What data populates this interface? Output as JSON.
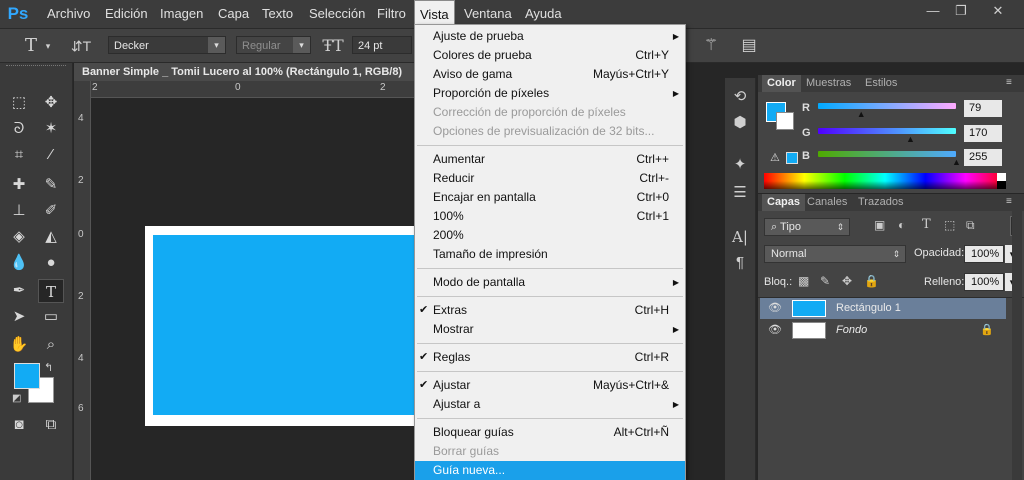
{
  "menubar": {
    "logo": "Ps",
    "items": [
      "Archivo",
      "Edición",
      "Imagen",
      "Capa",
      "Texto",
      "Selección",
      "Filtro",
      "Vista",
      "Ventana",
      "Ayuda"
    ],
    "active": "Vista"
  },
  "window_controls": {
    "minimize": "—",
    "restore": "❐",
    "close": "✕"
  },
  "options_bar": {
    "font_family": "Decker",
    "font_style": "Regular",
    "font_size": "24 pt"
  },
  "document": {
    "tab_title": "Banner Simple _ Tomii Lucero al 100% (Rectángulo 1, RGB/8)",
    "ruler_top": [
      "2",
      "0",
      "2"
    ],
    "ruler_left": [
      "4",
      "2",
      "0",
      "2",
      "4",
      "6"
    ],
    "colors": {
      "border": "#ffffff",
      "fill": "#12abf4"
    }
  },
  "vista_menu": {
    "items": [
      {
        "label": "Ajuste de prueba",
        "shortcut": "",
        "submenu": true,
        "checked": false,
        "disabled": false
      },
      {
        "label": "Colores de prueba",
        "shortcut": "Ctrl+Y",
        "submenu": false,
        "checked": false,
        "disabled": false
      },
      {
        "label": "Aviso de gama",
        "shortcut": "Mayús+Ctrl+Y",
        "submenu": false,
        "checked": false,
        "disabled": false
      },
      {
        "label": "Proporción de píxeles",
        "shortcut": "",
        "submenu": true,
        "checked": false,
        "disabled": false
      },
      {
        "label": "Corrección de proporción de píxeles",
        "shortcut": "",
        "submenu": false,
        "checked": false,
        "disabled": true
      },
      {
        "label": "Opciones de previsualización de 32 bits...",
        "shortcut": "",
        "submenu": false,
        "checked": false,
        "disabled": true
      },
      {
        "label": "Aumentar",
        "shortcut": "Ctrl++",
        "submenu": false,
        "checked": false,
        "disabled": false
      },
      {
        "label": "Reducir",
        "shortcut": "Ctrl+-",
        "submenu": false,
        "checked": false,
        "disabled": false
      },
      {
        "label": "Encajar en pantalla",
        "shortcut": "Ctrl+0",
        "submenu": false,
        "checked": false,
        "disabled": false
      },
      {
        "label": "100%",
        "shortcut": "Ctrl+1",
        "submenu": false,
        "checked": false,
        "disabled": false
      },
      {
        "label": "200%",
        "shortcut": "",
        "submenu": false,
        "checked": false,
        "disabled": false
      },
      {
        "label": "Tamaño de impresión",
        "shortcut": "",
        "submenu": false,
        "checked": false,
        "disabled": false
      },
      {
        "label": "Modo de pantalla",
        "shortcut": "",
        "submenu": true,
        "checked": false,
        "disabled": false
      },
      {
        "label": "Extras",
        "shortcut": "Ctrl+H",
        "submenu": false,
        "checked": true,
        "disabled": false
      },
      {
        "label": "Mostrar",
        "shortcut": "",
        "submenu": true,
        "checked": false,
        "disabled": false
      },
      {
        "label": "Reglas",
        "shortcut": "Ctrl+R",
        "submenu": false,
        "checked": true,
        "disabled": false
      },
      {
        "label": "Ajustar",
        "shortcut": "Mayús+Ctrl+&",
        "submenu": false,
        "checked": true,
        "disabled": false
      },
      {
        "label": "Ajustar a",
        "shortcut": "",
        "submenu": true,
        "checked": false,
        "disabled": false
      },
      {
        "label": "Bloquear guías",
        "shortcut": "Alt+Ctrl+Ñ",
        "submenu": false,
        "checked": false,
        "disabled": false
      },
      {
        "label": "Borrar guías",
        "shortcut": "",
        "submenu": false,
        "checked": false,
        "disabled": true
      },
      {
        "label": "Guía nueva...",
        "shortcut": "",
        "submenu": false,
        "checked": false,
        "disabled": false,
        "highlighted": true
      }
    ]
  },
  "color_panel": {
    "tabs": [
      "Color",
      "Muestras",
      "Estilos"
    ],
    "active_tab": "Color",
    "r_label": "R",
    "g_label": "G",
    "b_label": "B",
    "r": "79",
    "g": "170",
    "b": "255",
    "r_level": 0.31,
    "g_level": 0.667,
    "b_level": 1.0,
    "foreground": "#12abf4",
    "background": "#ffffff"
  },
  "layers_panel": {
    "tabs": [
      "Capas",
      "Canales",
      "Trazados"
    ],
    "active_tab": "Capas",
    "filter": "Tipo",
    "blend_mode": "Normal",
    "opacity_label": "Opacidad:",
    "opacity": "100%",
    "lock_label": "Bloq.:",
    "fill_label": "Relleno:",
    "fill": "100%",
    "layers": [
      {
        "name": "Rectángulo 1",
        "selected": true,
        "locked": false
      },
      {
        "name": "Fondo",
        "selected": false,
        "locked": true
      }
    ]
  },
  "toolbox": {
    "foreground": "#12abf4",
    "background": "#ffffff"
  }
}
